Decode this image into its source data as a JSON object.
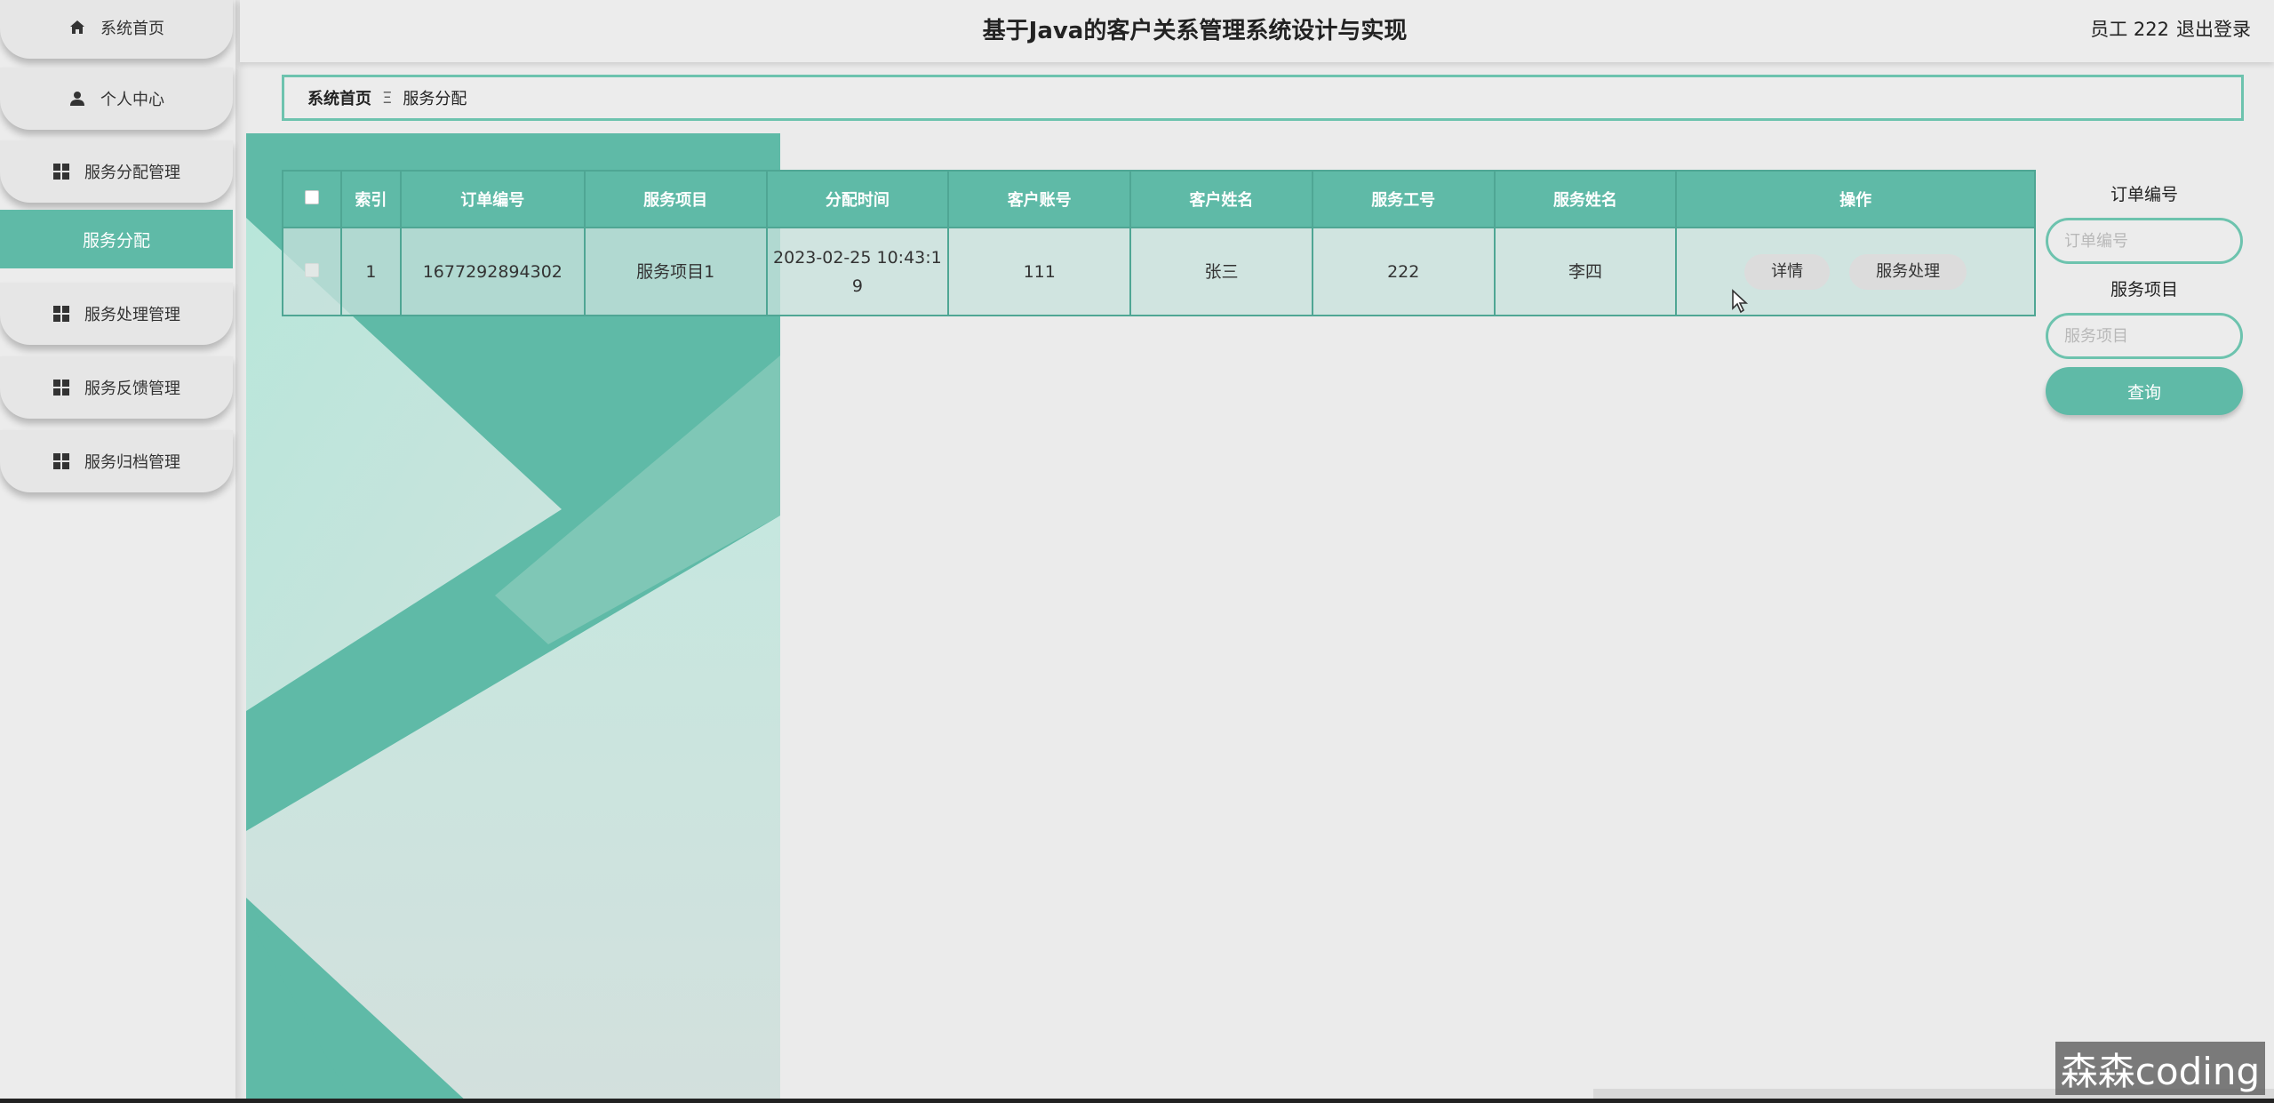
{
  "header": {
    "title": "基于Java的客户关系管理系统设计与实现",
    "user": "员工 222",
    "logout": "退出登录"
  },
  "sidebar": {
    "items": [
      {
        "label": "系统首页",
        "icon": "home-icon"
      },
      {
        "label": "个人中心",
        "icon": "user-icon"
      },
      {
        "label": "服务分配管理",
        "icon": "grid-icon"
      },
      {
        "label": "服务分配",
        "icon": ""
      },
      {
        "label": "服务处理管理",
        "icon": "grid-icon"
      },
      {
        "label": "服务反馈管理",
        "icon": "grid-icon"
      },
      {
        "label": "服务归档管理",
        "icon": "grid-icon"
      }
    ]
  },
  "breadcrumb": {
    "home": "系统首页",
    "separator": "Ξ",
    "current": "服务分配"
  },
  "table": {
    "columns": [
      "索引",
      "订单编号",
      "服务项目",
      "分配时间",
      "客户账号",
      "客户姓名",
      "服务工号",
      "服务姓名",
      "操作"
    ],
    "rows": [
      {
        "index": "1",
        "order_no": "1677292894302",
        "service_item": "服务项目1",
        "assign_time_line1": "2023-02-25 10:43:1",
        "assign_time_line2": "9",
        "customer_account": "111",
        "customer_name": "张三",
        "service_no": "222",
        "service_name": "李四",
        "actions": {
          "detail": "详情",
          "process": "服务处理"
        }
      }
    ]
  },
  "search": {
    "order_label": "订单编号",
    "order_placeholder": "订单编号",
    "item_label": "服务项目",
    "item_placeholder": "服务项目",
    "button": "查询"
  },
  "watermark": "森森coding",
  "colors": {
    "accent": "#5fbaa7",
    "accent_border": "#6dc3ae",
    "background": "#ebebeb"
  }
}
